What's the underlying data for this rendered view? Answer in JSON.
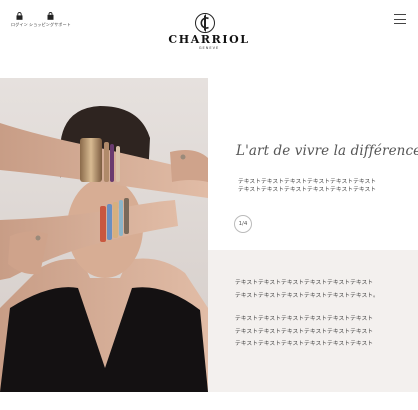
{
  "header": {
    "login_label": "ログイン",
    "shop_support_label": "ショッピングサポート",
    "brand": "CHARRIOL",
    "brand_sub": "GENEVE"
  },
  "hero": {
    "image_description": "Model with crossed arms wearing stacked bangles and cuffs"
  },
  "intro": {
    "headline": "L'art de vivre la différence",
    "text": "テキストテキストテキストテキストテキストテキスト\nテキストテキストテキストテキストテキストテキスト",
    "pager": "1/4"
  },
  "body": {
    "para1": "テキストテキストテキストテキストテキストテキスト\nテキストテキストテキストテキストテキストテキスト。",
    "para2": "テキストテキストテキストテキストテキストテキスト\nテキストテキストテキストテキストテキストテキスト\nテキストテキストテキストテキストテキストテキスト"
  },
  "colors": {
    "panel_bg": "#f3f0ee",
    "hero_bg": "#dcd6d2",
    "dress": "#141112"
  }
}
